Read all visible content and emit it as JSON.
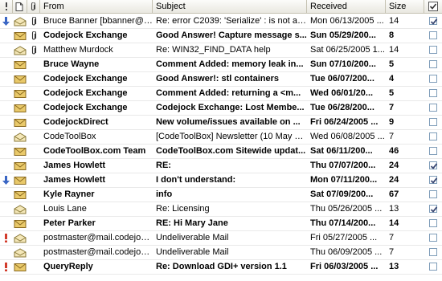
{
  "columns": {
    "priority_icon": "priority-icon",
    "type_icon": "document-icon",
    "attachment_icon": "paperclip-icon",
    "from": "From",
    "subject": "Subject",
    "received": "Received",
    "size": "Size",
    "flag_icon": "checkbox-icon"
  },
  "colors": {
    "envelope_closed": "#e9c96a",
    "envelope_open": "#f4e7b8",
    "priority_low": "#3a66c4",
    "priority_high": "#d23b2b",
    "check_mark": "#3c4a74"
  },
  "messages": [
    {
      "priority": "low",
      "read": true,
      "attachment": true,
      "from": "Bruce Banner [bbanner@c...",
      "subject": "Re: error C2039: 'Serialize' : is not a m...",
      "received": "Mon 06/13/2005 ...",
      "size": "14",
      "checked": true
    },
    {
      "priority": "",
      "read": false,
      "attachment": true,
      "from": "Codejock Exchange",
      "subject": "Good Answer! Capture message s...",
      "received": "Sun 05/29/200...",
      "size": "8",
      "checked": false
    },
    {
      "priority": "",
      "read": true,
      "attachment": true,
      "from": "Matthew Murdock",
      "subject": "Re: WIN32_FIND_DATA help",
      "received": "Sat 06/25/2005 1...",
      "size": "14",
      "checked": false
    },
    {
      "priority": "",
      "read": false,
      "attachment": false,
      "from": "Bruce Wayne",
      "subject": "Comment Added: memory leak in...",
      "received": "Sun 07/10/200...",
      "size": "5",
      "checked": false
    },
    {
      "priority": "",
      "read": false,
      "attachment": false,
      "from": "Codejock Exchange",
      "subject": "Good Answer!: stl containers",
      "received": "Tue 06/07/200...",
      "size": "4",
      "checked": false
    },
    {
      "priority": "",
      "read": false,
      "attachment": false,
      "from": "Codejock Exchange",
      "subject": "Comment Added: returning a <m...",
      "received": "Wed 06/01/20...",
      "size": "5",
      "checked": false
    },
    {
      "priority": "",
      "read": false,
      "attachment": false,
      "from": "Codejock Exchange",
      "subject": "Codejock Exchange:  Lost Membe...",
      "received": "Tue 06/28/200...",
      "size": "7",
      "checked": false
    },
    {
      "priority": "",
      "read": false,
      "attachment": false,
      "from": "CodejockDirect",
      "subject": "New volume/issues available on ...",
      "received": "Fri 06/24/2005 ...",
      "size": "9",
      "checked": false
    },
    {
      "priority": "",
      "read": true,
      "attachment": false,
      "from": "CodeToolBox",
      "subject": "[CodeToolBox] Newsletter (10 May 20...",
      "received": "Wed 06/08/2005 ...",
      "size": "7",
      "checked": false
    },
    {
      "priority": "",
      "read": false,
      "attachment": false,
      "from": "CodeToolBox.com Team",
      "subject": "CodeToolBox.com Sitewide updat...",
      "received": "Sat 06/11/200...",
      "size": "46",
      "checked": false
    },
    {
      "priority": "",
      "read": false,
      "attachment": false,
      "from": "James Howlett",
      "subject": "RE:",
      "received": "Thu 07/07/200...",
      "size": "24",
      "checked": true
    },
    {
      "priority": "low",
      "read": false,
      "attachment": false,
      "from": "James Howlett",
      "subject": "I don't understand:",
      "received": "Mon 07/11/200...",
      "size": "24",
      "checked": true
    },
    {
      "priority": "",
      "read": false,
      "attachment": false,
      "from": "Kyle Rayner",
      "subject": "info",
      "received": "Sat 07/09/200...",
      "size": "67",
      "checked": false
    },
    {
      "priority": "",
      "read": true,
      "attachment": false,
      "from": "Louis Lane",
      "subject": "Re: Licensing",
      "received": "Thu 05/26/2005 ...",
      "size": "13",
      "checked": true
    },
    {
      "priority": "",
      "read": false,
      "attachment": false,
      "from": "Peter Parker",
      "subject": "RE: Hi Mary Jane",
      "received": "Thu 07/14/200...",
      "size": "14",
      "checked": false
    },
    {
      "priority": "high",
      "read": true,
      "attachment": false,
      "from": "postmaster@mail.codejock...",
      "subject": "Undeliverable Mail",
      "received": "Fri 05/27/2005 ...",
      "size": "7",
      "checked": false
    },
    {
      "priority": "",
      "read": true,
      "attachment": false,
      "from": "postmaster@mail.codejock...",
      "subject": "Undeliverable Mail",
      "received": "Thu 06/09/2005 ...",
      "size": "7",
      "checked": false
    },
    {
      "priority": "high",
      "read": false,
      "attachment": false,
      "from": "QueryReply",
      "subject": "Re: Download GDI+ version 1.1",
      "received": "Fri 06/03/2005 ...",
      "size": "13",
      "checked": false
    }
  ]
}
